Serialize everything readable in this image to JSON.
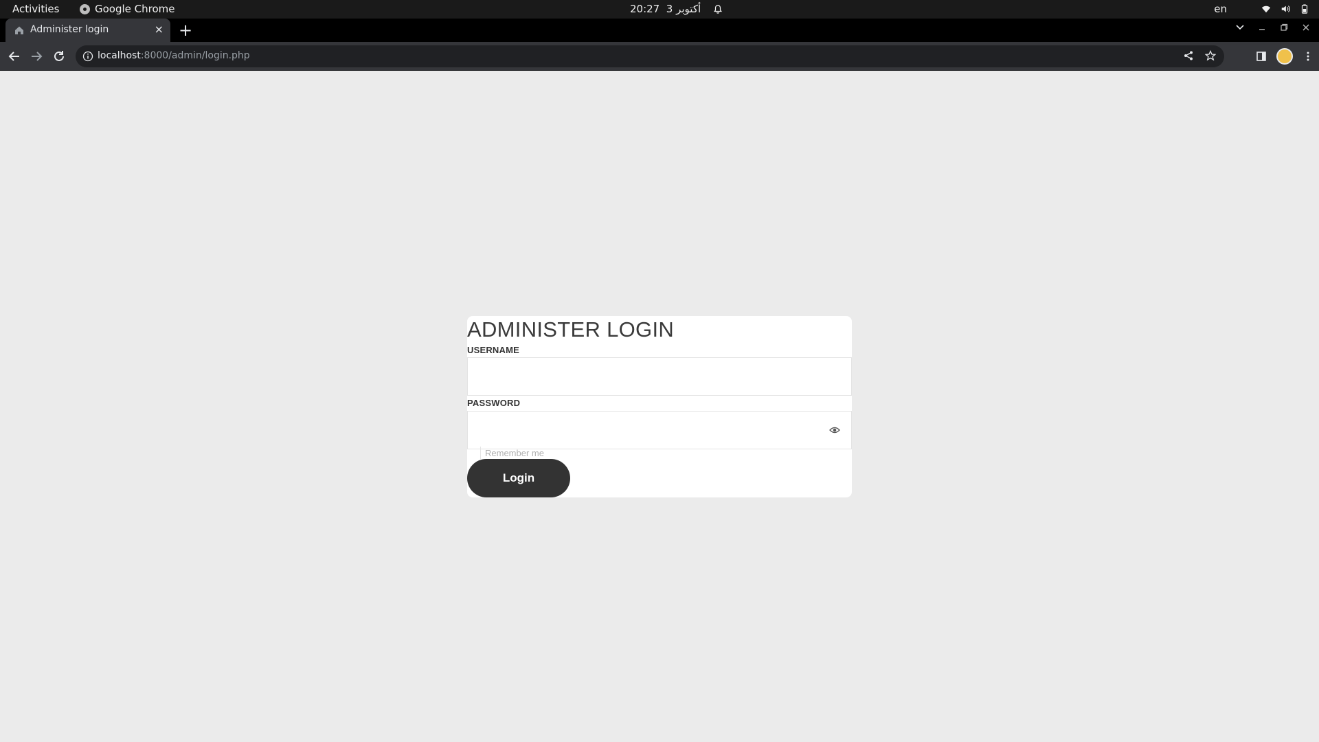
{
  "system_bar": {
    "activities": "Activities",
    "app_name": "Google Chrome",
    "time": "20:27",
    "date": "3 أكتوبر",
    "language": "en"
  },
  "browser": {
    "tab": {
      "title": "Administer login",
      "close": "×"
    },
    "new_tab": "+",
    "url_host": "localhost",
    "url_rest": ":8000/admin/login.php"
  },
  "login": {
    "title": "ADMINISTER LOGIN",
    "username_label": "USERNAME",
    "username_value": "",
    "password_label": "PASSWORD",
    "password_value": "",
    "remember_label": "Remember me",
    "submit_label": "Login"
  }
}
